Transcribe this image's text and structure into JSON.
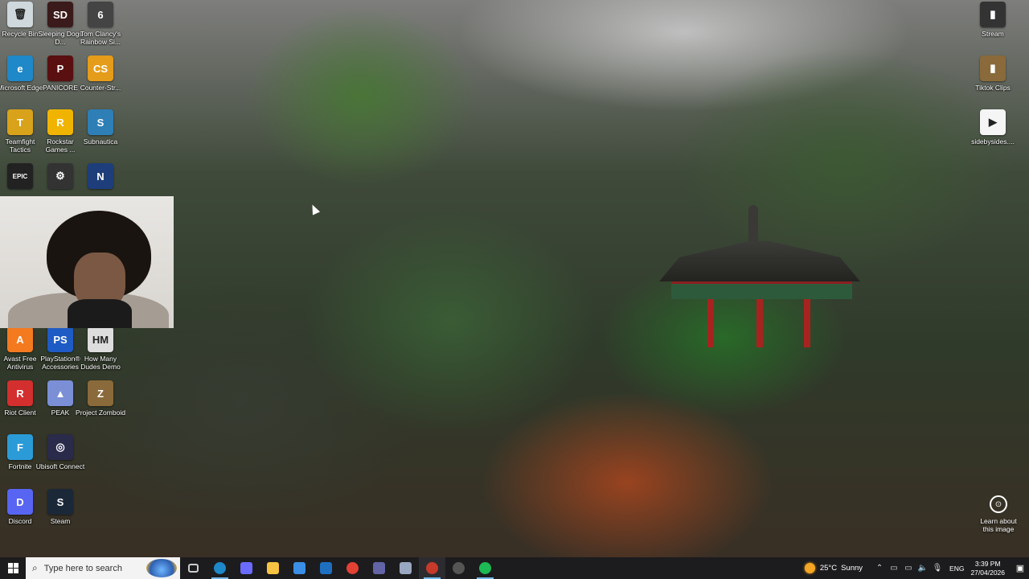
{
  "desktop_icons": [
    {
      "label": "Recycle Bin",
      "glyph": "🗑",
      "color": "#cfd8dc",
      "icon": "recycle-bin-icon"
    },
    {
      "label": "Sleeping Dogs D...",
      "glyph": "SD",
      "color": "#3a1a1a",
      "icon": "sleeping-dogs-icon"
    },
    {
      "label": "Tom Clancy's Rainbow Si...",
      "glyph": "6",
      "color": "#444444",
      "icon": "rainbow-six-icon"
    },
    {
      "label": "Microsoft Edge",
      "glyph": "e",
      "color": "#1e88c8",
      "icon": "edge-icon"
    },
    {
      "label": "PANICORE",
      "glyph": "P",
      "color": "#5a1010",
      "icon": "panicore-icon"
    },
    {
      "label": "Counter-Str...",
      "glyph": "CS",
      "color": "#e59c1a",
      "icon": "counter-strike-icon"
    },
    {
      "label": "Teamfight Tactics",
      "glyph": "T",
      "color": "#d8a21a",
      "icon": "teamfight-tactics-icon"
    },
    {
      "label": "Rockstar Games ...",
      "glyph": "R",
      "color": "#f0b400",
      "icon": "rockstar-icon"
    },
    {
      "label": "Subnautica",
      "glyph": "S",
      "color": "#2d7fb6",
      "icon": "subnautica-icon"
    },
    {
      "label": "",
      "glyph": "EPIC",
      "color": "#222222",
      "icon": "epic-games-icon"
    },
    {
      "label": "",
      "glyph": "⚙",
      "color": "#333333",
      "icon": "gear-app-icon"
    },
    {
      "label": "",
      "glyph": "N",
      "color": "#1d3e7a",
      "icon": "launcher-icon"
    },
    {
      "label": "Avast Free Antivirus",
      "glyph": "A",
      "color": "#f47a20",
      "icon": "avast-icon"
    },
    {
      "label": "PlayStation® Accessories",
      "glyph": "PS",
      "color": "#1f5bc4",
      "icon": "playstation-icon"
    },
    {
      "label": "How Many Dudes Demo",
      "glyph": "HM",
      "color": "#dddddd",
      "icon": "how-many-dudes-icon"
    },
    {
      "label": "Riot Client",
      "glyph": "R",
      "color": "#d32f2f",
      "icon": "riot-client-icon"
    },
    {
      "label": "PEAK",
      "glyph": "▲",
      "color": "#7b8fd6",
      "icon": "peak-icon"
    },
    {
      "label": "Project Zomboid",
      "glyph": "Z",
      "color": "#8a6a3a",
      "icon": "project-zomboid-icon"
    },
    {
      "label": "Fortnite",
      "glyph": "F",
      "color": "#2b9bd8",
      "icon": "fortnite-icon"
    },
    {
      "label": "Ubisoft Connect",
      "glyph": "◎",
      "color": "#2a2a4a",
      "icon": "ubisoft-connect-icon"
    },
    {
      "label": "",
      "glyph": "",
      "color": "",
      "icon": ""
    },
    {
      "label": "Discord",
      "glyph": "D",
      "color": "#5865f2",
      "icon": "discord-icon"
    },
    {
      "label": "Steam",
      "glyph": "S",
      "color": "#1b2838",
      "icon": "steam-icon"
    },
    {
      "label": "Stream",
      "glyph": "▮",
      "color": "#333333",
      "icon": "stream-folder-icon"
    },
    {
      "label": "Tiktok Clips",
      "glyph": "▮",
      "color": "#8a6a3a",
      "icon": "tiktok-clips-icon"
    },
    {
      "label": "sidebysides....",
      "glyph": "▶",
      "color": "#f5f5f5",
      "icon": "video-file-icon"
    }
  ],
  "learn": {
    "label": "Learn about this image"
  },
  "search": {
    "placeholder": "Type here to search"
  },
  "taskbar_apps": [
    {
      "name": "task-view",
      "color": "#cccccc"
    },
    {
      "name": "edge",
      "color": "#1e88c8"
    },
    {
      "name": "copilot",
      "color": "#6b6bff"
    },
    {
      "name": "file-explorer",
      "color": "#f6c343"
    },
    {
      "name": "microsoft-store",
      "color": "#3a8ee6"
    },
    {
      "name": "outlook",
      "color": "#1e6fc0"
    },
    {
      "name": "chrome",
      "color": "#e34133"
    },
    {
      "name": "teams",
      "color": "#6264a7"
    },
    {
      "name": "app-unknown",
      "color": "#9aa7c0"
    },
    {
      "name": "chrome-profile",
      "color": "#c53a2a"
    },
    {
      "name": "obs",
      "color": "#555555"
    },
    {
      "name": "spotify",
      "color": "#1db954"
    }
  ],
  "tray": {
    "temperature": "25°C",
    "weather": "Sunny",
    "language": "ENG",
    "time": "3:39 PM",
    "date": "27/04/2026"
  }
}
